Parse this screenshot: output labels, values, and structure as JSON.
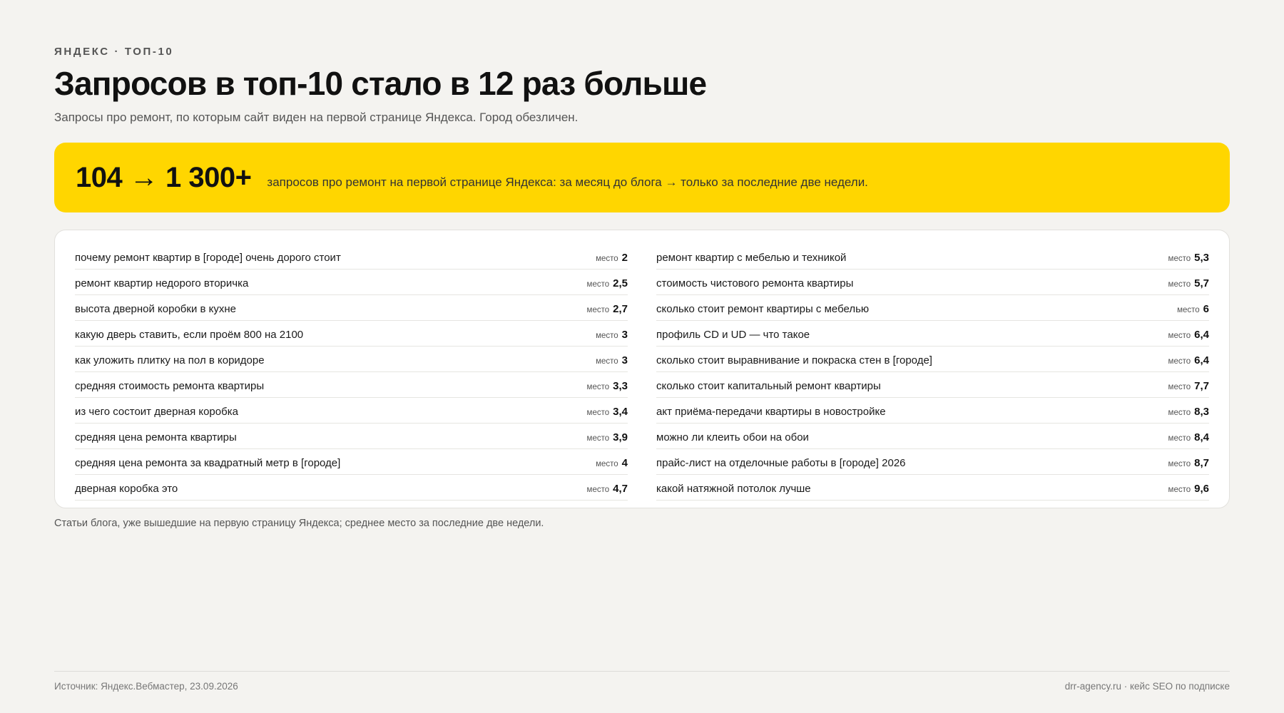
{
  "header": {
    "eyebrow": "ЯНДЕКС · ТОП-10",
    "title": "Запросов в топ-10 стало в 12 раз больше",
    "subtitle": "Запросы про ремонт, по которым сайт виден на первой странице Яндекса. Город обезличен."
  },
  "banner": {
    "figure": "104 → 1 300+",
    "text": "запросов про ремонт на первой странице Яндекса: за месяц до блога → только за последние две недели.",
    "color": "#ffd600"
  },
  "queries": {
    "position_label": "место",
    "left": [
      {
        "query": "почему ремонт квартир в [городе] очень дорого стоит",
        "position": "2"
      },
      {
        "query": "ремонт квартир недорого вторичка",
        "position": "2,5"
      },
      {
        "query": "высота дверной коробки в кухне",
        "position": "2,7"
      },
      {
        "query": "какую дверь ставить, если проём 800 на 2100",
        "position": "3"
      },
      {
        "query": "как уложить плитку на пол в коридоре",
        "position": "3"
      },
      {
        "query": "средняя стоимость ремонта квартиры",
        "position": "3,3"
      },
      {
        "query": "из чего состоит дверная коробка",
        "position": "3,4"
      },
      {
        "query": "средняя цена ремонта квартиры",
        "position": "3,9"
      },
      {
        "query": "средняя цена ремонта за квадратный метр в [городе]",
        "position": "4"
      },
      {
        "query": "дверная коробка это",
        "position": "4,7"
      }
    ],
    "right": [
      {
        "query": "ремонт квартир с мебелью и техникой",
        "position": "5,3"
      },
      {
        "query": "стоимость чистового ремонта квартиры",
        "position": "5,7"
      },
      {
        "query": "сколько стоит ремонт квартиры с мебелью",
        "position": "6"
      },
      {
        "query": "профиль CD и UD — что такое",
        "position": "6,4"
      },
      {
        "query": "сколько стоит выравнивание и покраска стен в [городе]",
        "position": "6,4"
      },
      {
        "query": "сколько стоит капитальный ремонт квартиры",
        "position": "7,7"
      },
      {
        "query": "акт приёма-передачи квартиры в новостройке",
        "position": "8,3"
      },
      {
        "query": "можно ли клеить обои на обои",
        "position": "8,4"
      },
      {
        "query": "прайс-лист на отделочные работы в [городе] 2026",
        "position": "8,7"
      },
      {
        "query": "какой натяжной потолок лучше",
        "position": "9,6"
      }
    ]
  },
  "caption": "Статьи блога, уже вышедшие на первую страницу Яндекса; среднее место за последние две недели.",
  "footer": {
    "source": "Источник: Яндекс.Вебмастер, 23.09.2026",
    "brand": "drr-agency.ru · кейс SEO по подписке"
  }
}
